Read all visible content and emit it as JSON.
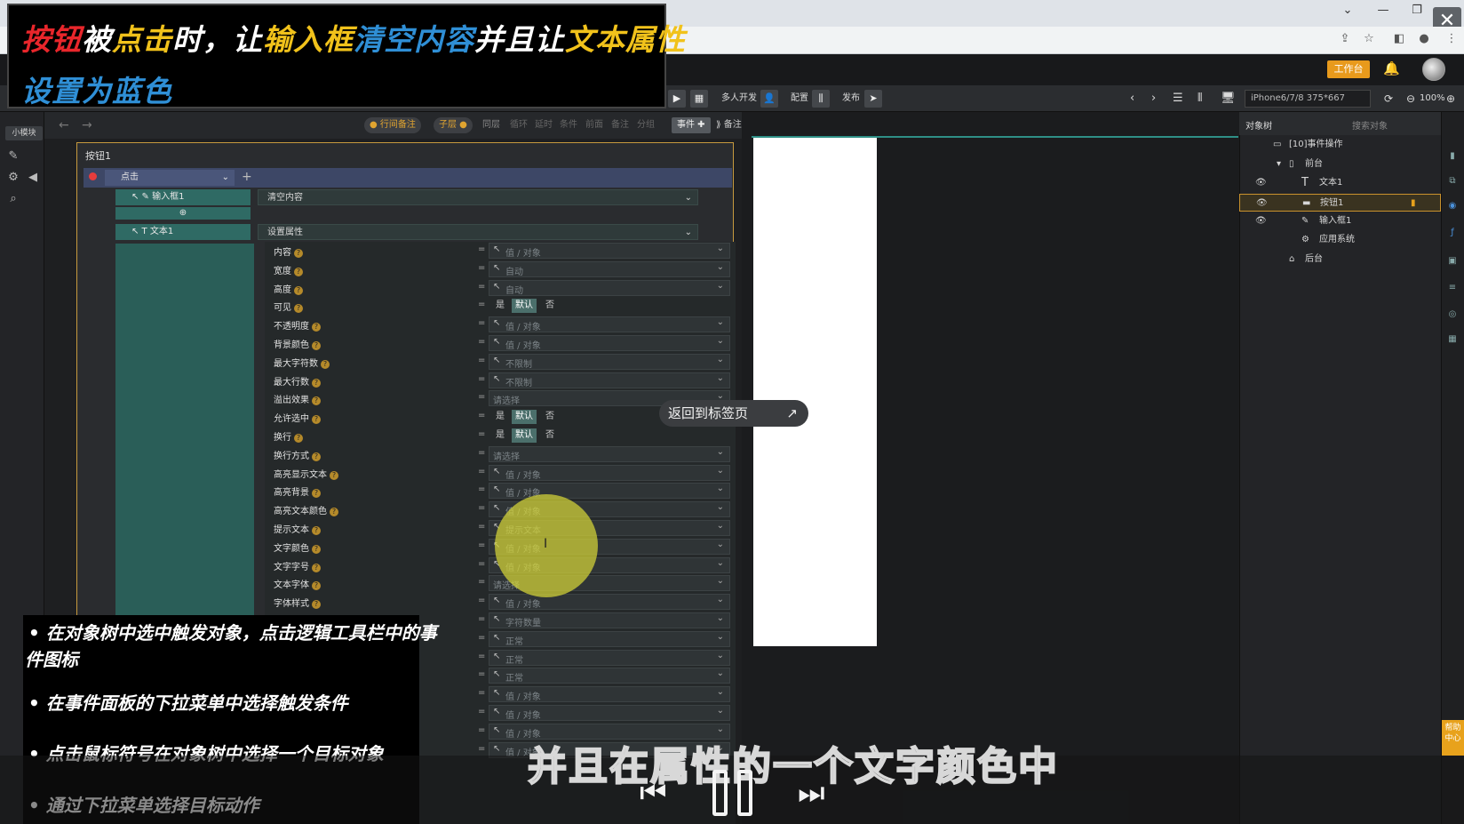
{
  "browser": {
    "min": "—",
    "max": "❐",
    "close": "✕",
    "chev": "⌄"
  },
  "header": {
    "workbench": "工作台"
  },
  "toolbar": {
    "multi_dev": "多人开发",
    "config": "配置",
    "publish": "发布",
    "device": "iPhone6/7/8 375*667",
    "zoom": "100%"
  },
  "left_strip": {
    "small_module": "小模块"
  },
  "event_bar": {
    "row_note": "行间备注",
    "child": "子层",
    "sync": "同层",
    "loop": "循环",
    "delay": "延时",
    "cond": "条件",
    "branch_a": "前面",
    "note": "备注",
    "group": "分组",
    "event_btn": "事件",
    "note_btn": "备注"
  },
  "event": {
    "title": "按钮1",
    "trigger": "点击",
    "target1": "输入框1",
    "action1": "清空内容",
    "target2": "文本1",
    "action2": "设置属性"
  },
  "properties": [
    {
      "label": "内容",
      "type": "field",
      "value": "值 / 对象"
    },
    {
      "label": "宽度",
      "type": "field",
      "value": "自动"
    },
    {
      "label": "高度",
      "type": "field",
      "value": "自动"
    },
    {
      "label": "可见",
      "type": "seg",
      "opts": [
        "是",
        "默认",
        "否"
      ]
    },
    {
      "label": "不透明度",
      "type": "field",
      "value": "值 / 对象"
    },
    {
      "label": "背景颜色",
      "type": "field",
      "value": "值 / 对象"
    },
    {
      "label": "最大字符数",
      "type": "field",
      "value": "不限制"
    },
    {
      "label": "最大行数",
      "type": "field",
      "value": "不限制"
    },
    {
      "label": "溢出效果",
      "type": "select",
      "value": "请选择"
    },
    {
      "label": "允许选中",
      "type": "seg",
      "opts": [
        "是",
        "默认",
        "否"
      ]
    },
    {
      "label": "换行",
      "type": "seg",
      "opts": [
        "是",
        "默认",
        "否"
      ]
    },
    {
      "label": "换行方式",
      "type": "select",
      "value": "请选择"
    },
    {
      "label": "高亮显示文本",
      "type": "field",
      "value": "值 / 对象"
    },
    {
      "label": "高亮背景",
      "type": "field",
      "value": "值 / 对象"
    },
    {
      "label": "高亮文本颜色",
      "type": "field",
      "value": "值 / 对象"
    },
    {
      "label": "提示文本",
      "type": "field",
      "value": "提示文本"
    },
    {
      "label": "文字颜色",
      "type": "field",
      "value": "值 / 对象"
    },
    {
      "label": "文字字号",
      "type": "field",
      "value": "值 / 对象"
    },
    {
      "label": "文本字体",
      "type": "select",
      "value": "请选择"
    },
    {
      "label": "字体样式",
      "type": "field",
      "value": "值 / 对象"
    },
    {
      "label": "",
      "type": "field",
      "value": "字符数量"
    },
    {
      "label": "",
      "type": "field",
      "value": "正常"
    },
    {
      "label": "",
      "type": "field",
      "value": "正常"
    },
    {
      "label": "",
      "type": "field",
      "value": "正常"
    },
    {
      "label": "",
      "type": "field",
      "value": "值 / 对象"
    },
    {
      "label": "",
      "type": "field",
      "value": "值 / 对象"
    },
    {
      "label": "",
      "type": "field",
      "value": "值 / 对象"
    },
    {
      "label": "",
      "type": "field",
      "value": "值 / 对象"
    }
  ],
  "tooltip": {
    "text": "返回到标签页",
    "icon": "↗"
  },
  "object_tree": {
    "tab": "对象树",
    "search": "搜索对象",
    "items": [
      {
        "label": "[10]事件操作"
      },
      {
        "label": "前台"
      },
      {
        "label": "文本1"
      },
      {
        "label": "按钮1"
      },
      {
        "label": "输入框1"
      },
      {
        "label": "应用系统"
      },
      {
        "label": "后台"
      }
    ]
  },
  "help_tab": "帮助中心",
  "overlay_title": {
    "line1": [
      {
        "t": "按钮",
        "c": "#e8262b"
      },
      {
        "t": "被",
        "c": "#ffffff"
      },
      {
        "t": "点击",
        "c": "#f1c21b"
      },
      {
        "t": "时，让",
        "c": "#ffffff"
      },
      {
        "t": "输入框",
        "c": "#f1c21b"
      },
      {
        "t": "清空内容",
        "c": "#2f8fd6"
      },
      {
        "t": "并且让",
        "c": "#ffffff"
      },
      {
        "t": "文本属性",
        "c": "#f1c21b"
      }
    ],
    "line2": "设置为蓝色",
    "line2_color": "#2f8fd6"
  },
  "tips": [
    "• 在对象树中选中触发对象，点击逻辑工具栏中的事",
    "件图标",
    "• 在事件面板的下拉菜单中选择触发条件",
    "• 点击鼠标符号在对象树中选择一个目标对象",
    "• 通过下拉菜单选择目标动作"
  ],
  "subtitle": "并且在属性的一个文字颜色中"
}
